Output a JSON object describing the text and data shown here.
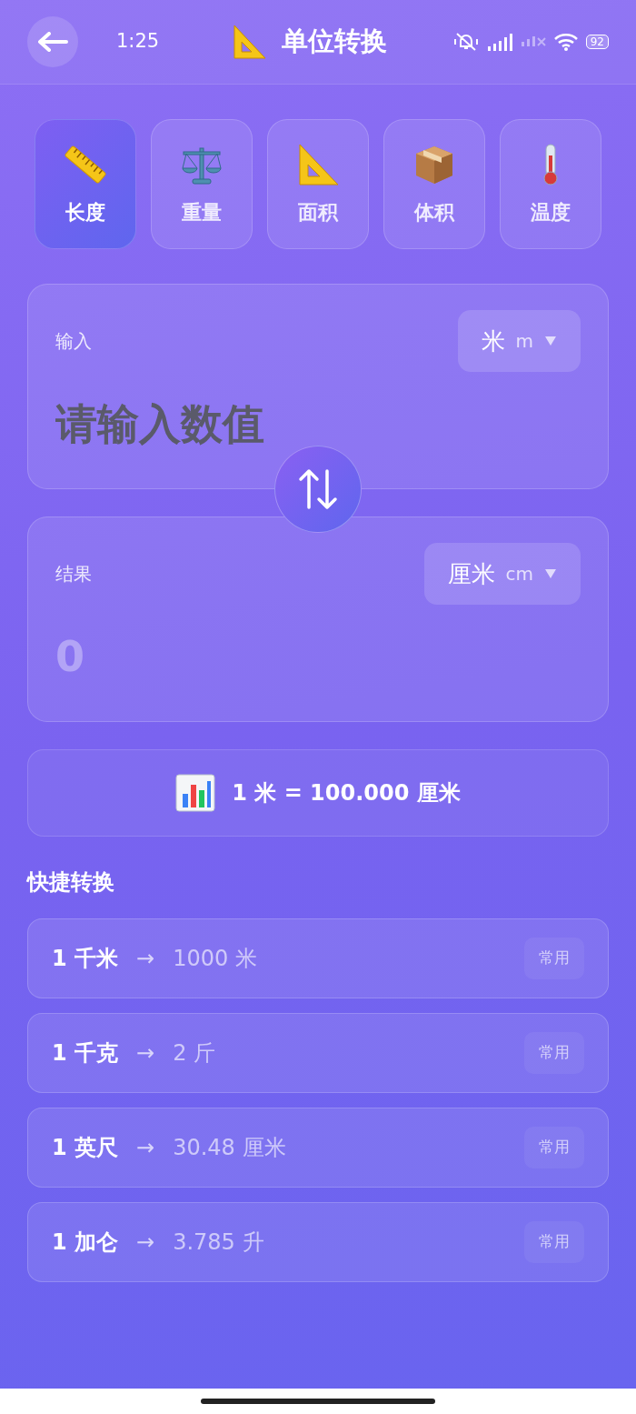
{
  "status_bar": {
    "time": "1:25",
    "battery": "92"
  },
  "header": {
    "title": "单位转换"
  },
  "categories": [
    {
      "label": "长度",
      "selected": true
    },
    {
      "label": "重量",
      "selected": false
    },
    {
      "label": "面积",
      "selected": false
    },
    {
      "label": "体积",
      "selected": false
    },
    {
      "label": "温度",
      "selected": false
    }
  ],
  "input": {
    "label": "输入",
    "placeholder": "请输入数值",
    "unit": {
      "name": "米",
      "symbol": "m"
    }
  },
  "result": {
    "label": "结果",
    "value": "0",
    "unit": {
      "name": "厘米",
      "symbol": "cm"
    }
  },
  "rate": "1 米 = 100.000 厘米",
  "quick": {
    "title": "快捷转换",
    "items": [
      {
        "from": "1 千米",
        "arrow": "→",
        "to": "1000 米",
        "tag": "常用"
      },
      {
        "from": "1 千克",
        "arrow": "→",
        "to": "2 斤",
        "tag": "常用"
      },
      {
        "from": "1 英尺",
        "arrow": "→",
        "to": "30.48 厘米",
        "tag": "常用"
      },
      {
        "from": "1 加仑",
        "arrow": "→",
        "to": "3.785 升",
        "tag": "常用"
      }
    ]
  }
}
